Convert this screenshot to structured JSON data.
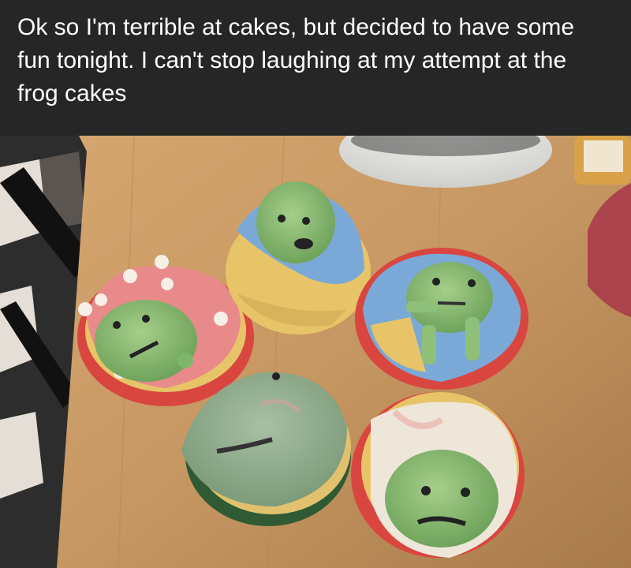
{
  "caption": {
    "text": "Ok so I'm terrible at cakes, but decided to have some fun tonight. I can't stop laughing at my attempt at the frog cakes"
  },
  "photo": {
    "subject": "five-cupcakes-with-green-frog-faces",
    "colors": {
      "table": "#c99a63",
      "floor_dark": "#3a3a3a",
      "frosting_green": "#8fc07a",
      "frosting_blue": "#7aa9d8",
      "frosting_pink": "#e88a8a",
      "frosting_white": "#efe6da",
      "cake_yellow": "#e7c468",
      "liner_red": "#d9463f"
    }
  }
}
